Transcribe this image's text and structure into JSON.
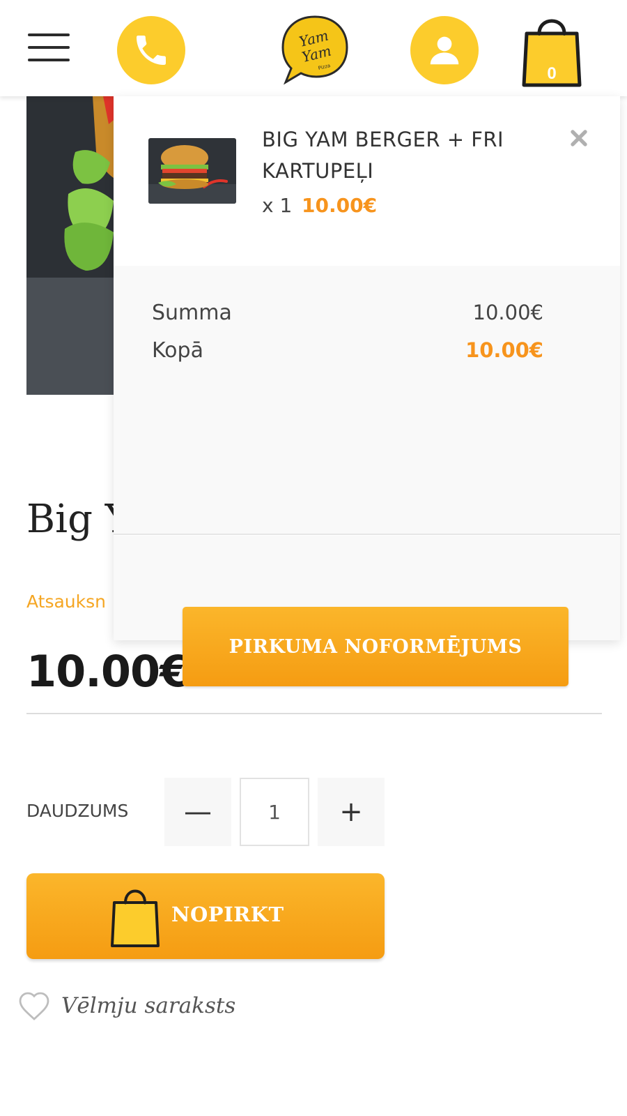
{
  "header": {
    "menu_icon": "hamburger-menu-icon",
    "phone_icon": "phone-icon",
    "logo_text": "Yam Yam",
    "user_icon": "user-icon",
    "cart_icon": "shopping-bag-icon",
    "cart_count": "0"
  },
  "product": {
    "title": "Big Y",
    "reviews_link": "Atsauksn",
    "price": "10.00€",
    "quantity_label": "DAUDZUMS",
    "quantity_value": "1",
    "minus_label": "—",
    "plus_label": "+",
    "buy_label": "NOPIRKT",
    "wishlist_label": "Vēlmju saraksts"
  },
  "mini_cart": {
    "items": [
      {
        "name": "BIG YAM BERGER + FRI KARTUPEĻI",
        "quantity": "x 1",
        "price": "10.00€"
      }
    ],
    "totals": {
      "sum_label": "Summa",
      "sum_value": "10.00€",
      "total_label": "Kopā",
      "total_value": "10.00€"
    },
    "checkout_label": "PIRKUMA NOFORMĒJUMS"
  },
  "colors": {
    "accent_yellow": "#fccc2c",
    "accent_orange": "#f7941d",
    "button_gradient_top": "#fbb62b",
    "button_gradient_bottom": "#f59c12"
  }
}
